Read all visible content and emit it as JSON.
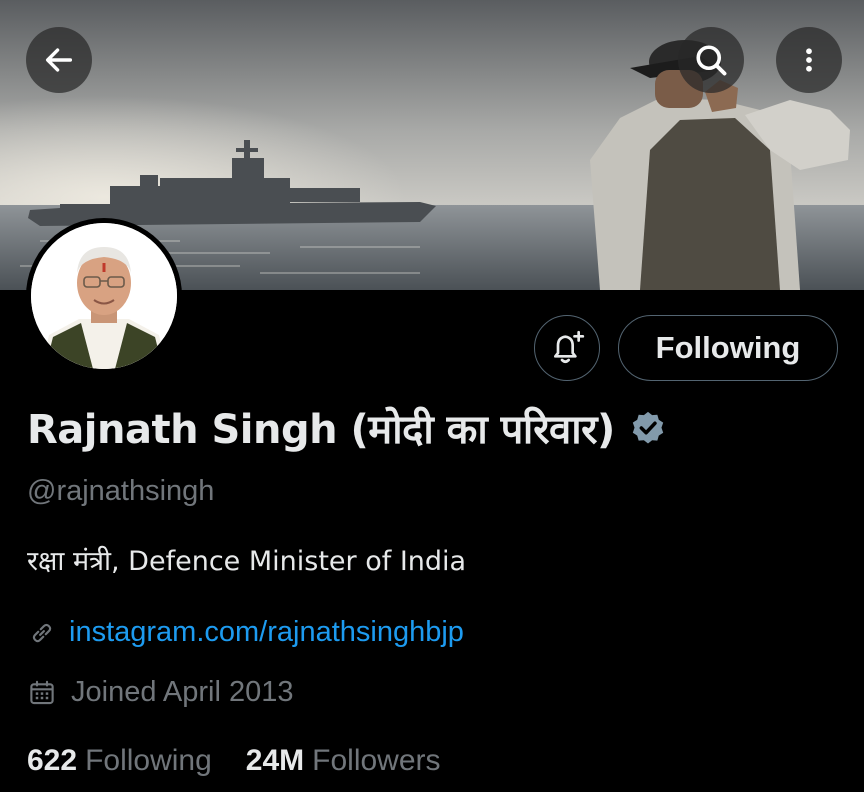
{
  "profile": {
    "display_name": "Rajnath Singh (मोदी का परिवार)",
    "handle": "@rajnathsingh",
    "bio": "रक्षा मंत्री, Defence Minister of India",
    "link": "instagram.com/rajnathsinghbjp",
    "joined": "Joined April 2013",
    "verified": true
  },
  "actions": {
    "following_label": "Following"
  },
  "stats": {
    "following_count": "622",
    "following_label": "Following",
    "followers_count": "24M",
    "followers_label": "Followers"
  },
  "colors": {
    "background": "#000000",
    "primary_text": "#e7e9ea",
    "secondary_text": "#71767b",
    "link": "#1d9bf0",
    "border": "#536471",
    "verified_badge": "#829aab"
  },
  "icons": {
    "back": "arrow-left-icon",
    "search": "search-icon",
    "more": "more-vertical-icon",
    "notify": "bell-plus-icon",
    "verified": "verified-badge-icon",
    "link": "link-icon",
    "calendar": "calendar-icon"
  }
}
